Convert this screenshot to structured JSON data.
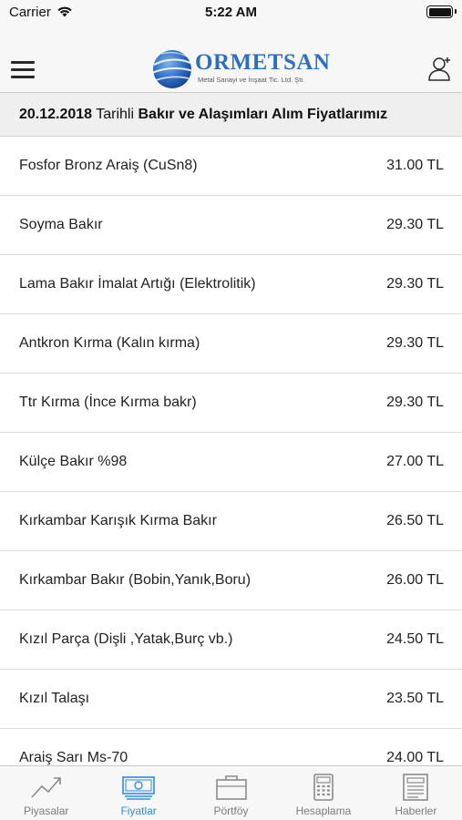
{
  "status_bar": {
    "carrier": "Carrier",
    "time": "5:22 AM"
  },
  "header": {
    "logo_name": "ORMETSAN",
    "logo_subtitle": "Metal Sanayi ve İnşaat Tic. Ltd. Şti.",
    "menu_icon": "hamburger-menu-icon",
    "user_icon": "user-plus-icon"
  },
  "title_bar": {
    "date": "20.12.2018",
    "word_tarihli": "Tarihli",
    "heading": "Bakır ve Alaşımları Alım Fiyatlarımız"
  },
  "prices": [
    {
      "name": "Fosfor Bronz Araiş (CuSn8)",
      "price": "31.00 TL"
    },
    {
      "name": "Soyma Bakır",
      "price": "29.30 TL"
    },
    {
      "name": "Lama Bakır İmalat Artığı (Elektrolitik)",
      "price": "29.30 TL"
    },
    {
      "name": "Antkron Kırma (Kalın kırma)",
      "price": "29.30 TL"
    },
    {
      "name": "Ttr Kırma (İnce Kırma bakr)",
      "price": "29.30 TL"
    },
    {
      "name": "Külçe Bakır %98",
      "price": "27.00 TL"
    },
    {
      "name": "Kırkambar Karışık Kırma Bakır",
      "price": "26.50 TL"
    },
    {
      "name": "Kırkambar Bakır (Bobin,Yanık,Boru)",
      "price": "26.00 TL"
    },
    {
      "name": "Kızıl Parça (Dişli ,Yatak,Burç vb.)",
      "price": "24.50 TL"
    },
    {
      "name": "Kızıl Talaşı",
      "price": "23.50 TL"
    },
    {
      "name": "Araiş Sarı Ms-70",
      "price": "24.00 TL"
    }
  ],
  "tabs": [
    {
      "label": "Piyasalar",
      "icon": "trend-chart-icon",
      "active": false
    },
    {
      "label": "Fiyatlar",
      "icon": "banknote-icon",
      "active": true
    },
    {
      "label": "Pörtföy",
      "icon": "briefcase-icon",
      "active": false
    },
    {
      "label": "Hesaplama",
      "icon": "calculator-icon",
      "active": false
    },
    {
      "label": "Haberler",
      "icon": "newspaper-icon",
      "active": false
    }
  ],
  "colors": {
    "accent": "#2e8be6",
    "logo_blue": "#2f6fbf",
    "inactive": "#7c7c7c"
  }
}
